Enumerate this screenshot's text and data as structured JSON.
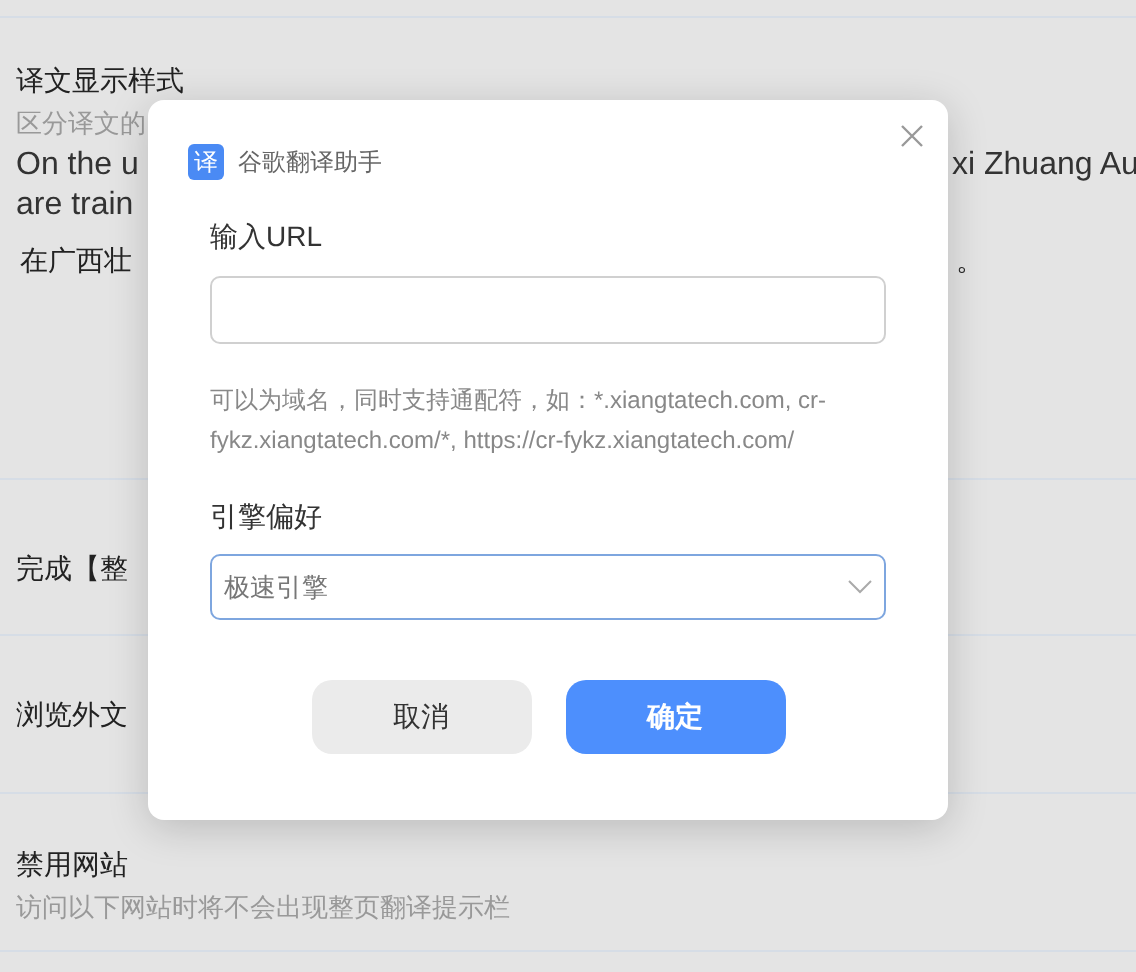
{
  "settings": [
    {
      "lines": [
        {
          "kind": "title",
          "left": "译文显示样式"
        },
        {
          "kind": "description",
          "left": "区分译文的"
        },
        {
          "kind": "text",
          "left": "On the u",
          "right": "xi Zhuang Au"
        },
        {
          "kind": "text",
          "left": "are train"
        },
        {
          "kind": "translation",
          "left": "在广西壮",
          "right": "。"
        }
      ]
    },
    {
      "lines": [
        {
          "kind": "title",
          "left": "完成【整"
        }
      ]
    },
    {
      "lines": [
        {
          "kind": "title",
          "left": "浏览外文"
        }
      ]
    },
    {
      "lines": [
        {
          "kind": "title",
          "left": "禁用网站"
        },
        {
          "kind": "description",
          "left": "访问以下网站时将不会出现整页翻译提示栏"
        }
      ]
    }
  ],
  "dialog": {
    "logo": "译",
    "title": "谷歌翻译助手",
    "url_label": "输入URL",
    "hint": "可以为域名，同时支持通配符，如：*.xiangtatech.com, cr-fykz.xiangtatech.com/*, https://cr-fykz.xiangtatech.com/",
    "engine_label": "引擎偏好",
    "engine_value": "极速引擎",
    "cancel": "取消",
    "confirm": "确定"
  }
}
